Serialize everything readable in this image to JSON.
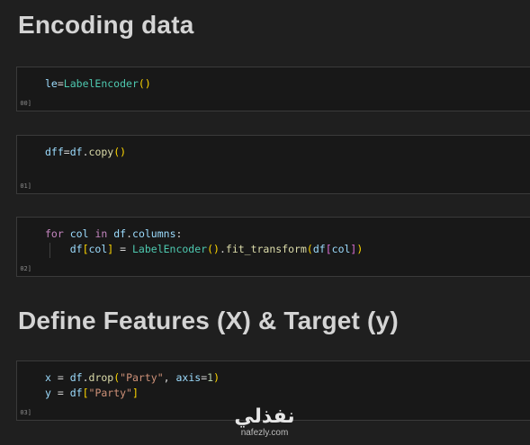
{
  "headings": {
    "encoding": "Encoding data",
    "features": "Define Features (X) & Target (y)"
  },
  "cells": [
    {
      "exec_label": "00]",
      "lines": [
        [
          [
            "var",
            "le"
          ],
          [
            "op",
            "="
          ],
          [
            "cls",
            "LabelEncoder"
          ],
          [
            "br1",
            "()"
          ]
        ]
      ]
    },
    {
      "exec_label": "01]",
      "lines": [
        [
          [
            "var",
            "dff"
          ],
          [
            "op",
            "="
          ],
          [
            "var",
            "df"
          ],
          [
            "op",
            "."
          ],
          [
            "fn",
            "copy"
          ],
          [
            "br1",
            "()"
          ]
        ]
      ]
    },
    {
      "exec_label": "02]",
      "lines": [
        [
          [
            "kw",
            "for"
          ],
          [
            "op",
            " "
          ],
          [
            "var",
            "col"
          ],
          [
            "op",
            " "
          ],
          [
            "kw",
            "in"
          ],
          [
            "op",
            " "
          ],
          [
            "var",
            "df"
          ],
          [
            "op",
            "."
          ],
          [
            "var",
            "columns"
          ],
          [
            "op",
            ":"
          ]
        ],
        [
          [
            "op",
            "    "
          ],
          [
            "var",
            "df"
          ],
          [
            "br1",
            "["
          ],
          [
            "var",
            "col"
          ],
          [
            "br1",
            "]"
          ],
          [
            "op",
            " = "
          ],
          [
            "cls",
            "LabelEncoder"
          ],
          [
            "br1",
            "()"
          ],
          [
            "op",
            "."
          ],
          [
            "fn",
            "fit_transform"
          ],
          [
            "br1",
            "("
          ],
          [
            "var",
            "df"
          ],
          [
            "br2",
            "["
          ],
          [
            "var",
            "col"
          ],
          [
            "br2",
            "]"
          ],
          [
            "br1",
            ")"
          ]
        ]
      ]
    },
    {
      "exec_label": "03]",
      "lines": [
        [
          [
            "var",
            "x"
          ],
          [
            "op",
            " = "
          ],
          [
            "var",
            "df"
          ],
          [
            "op",
            "."
          ],
          [
            "fn",
            "drop"
          ],
          [
            "br1",
            "("
          ],
          [
            "str",
            "\"Party\""
          ],
          [
            "op",
            ", "
          ],
          [
            "var",
            "axis"
          ],
          [
            "op",
            "="
          ],
          [
            "num",
            "1"
          ],
          [
            "br1",
            ")"
          ]
        ],
        [
          [
            "var",
            "y"
          ],
          [
            "op",
            " = "
          ],
          [
            "var",
            "df"
          ],
          [
            "br1",
            "["
          ],
          [
            "str",
            "\"Party\""
          ],
          [
            "br1",
            "]"
          ]
        ]
      ]
    }
  ],
  "watermark": {
    "logo": "نفذلي",
    "url": "nafezly.com"
  }
}
